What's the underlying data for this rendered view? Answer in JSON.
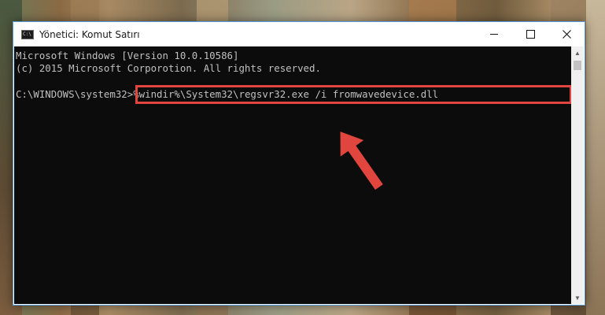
{
  "window": {
    "title": "Yönetici: Komut Satırı",
    "icon_text": "C:\\"
  },
  "console": {
    "lines": [
      "Microsoft Windows [Version 10.0.10586]",
      "(c) 2015 Microsoft Corporotion. All rights reserved."
    ],
    "prompt": "C:\\WINDOWS\\system32>",
    "command": "%windir%\\System32\\regsvr32.exe /i fromwavedevice.dll"
  },
  "colors": {
    "highlight": "#e0463d",
    "console_bg": "#0c0c0c",
    "console_text": "#c0c0c0",
    "window_border": "#5a9bd8"
  },
  "icons": [
    "cmd-app-icon",
    "minimize-icon",
    "maximize-icon",
    "close-icon",
    "scroll-up-icon",
    "scroll-down-icon",
    "arrow-pointer-icon"
  ]
}
